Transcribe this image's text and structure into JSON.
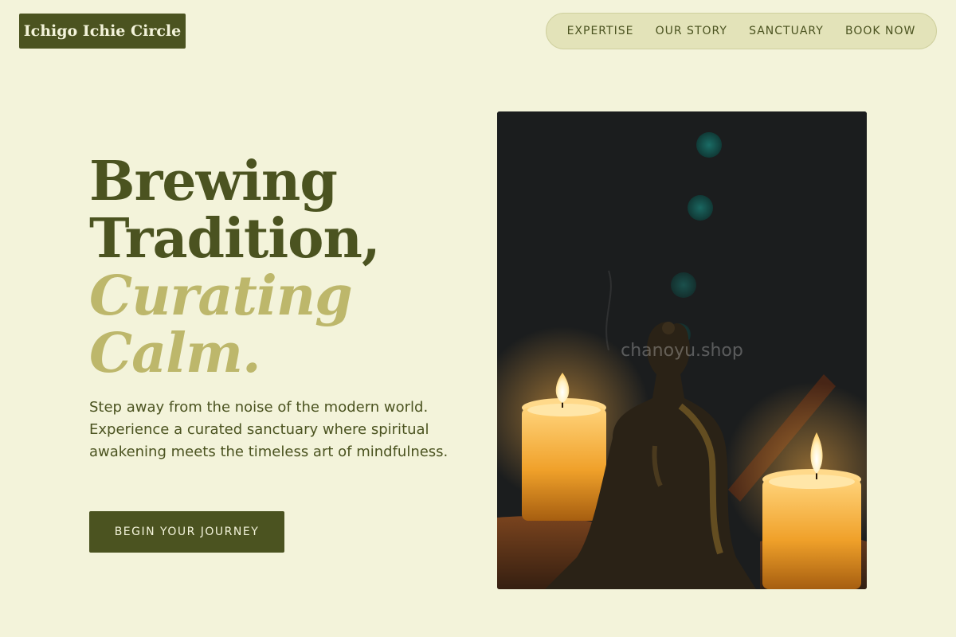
{
  "brand": {
    "name": "Ichigo Ichie Circle"
  },
  "nav": {
    "items": [
      {
        "label": "EXPERTISE"
      },
      {
        "label": "OUR STORY"
      },
      {
        "label": "SANCTUARY"
      },
      {
        "label": "BOOK NOW"
      }
    ]
  },
  "hero": {
    "title_line1": "Brewing",
    "title_line2": "Tradition,",
    "title_line3": "Curating",
    "title_line4": "Calm.",
    "description": "Step away from the noise of the modern world. Experience a curated sanctuary where spiritual awakening meets the timeless art of mindfulness.",
    "cta_label": "BEGIN YOUR JOURNEY"
  },
  "image": {
    "watermark": "chanoyu.shop"
  },
  "colors": {
    "background": "#f3f3da",
    "primary": "#4b5320",
    "accent": "#bdb76b",
    "nav_pill": "#e3e3b9"
  },
  "icons": [
    "buddha-statue",
    "candle",
    "candle"
  ]
}
